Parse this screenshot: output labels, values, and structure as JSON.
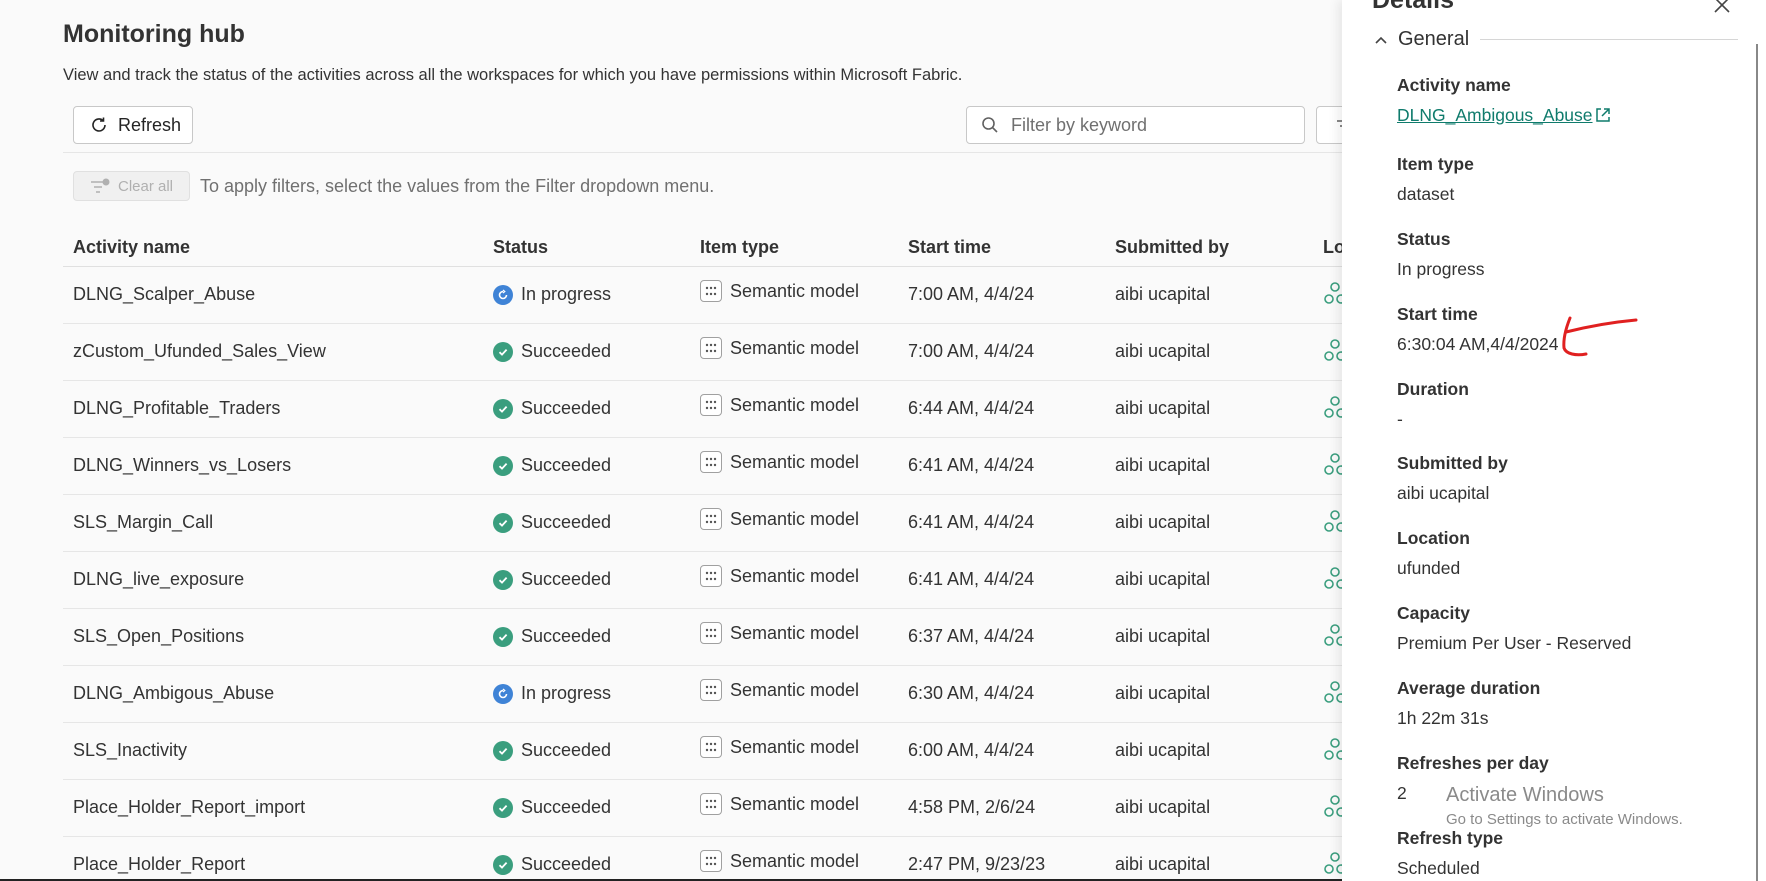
{
  "header": {
    "title": "Monitoring hub",
    "subtitle": "View and track the status of the activities across all the workspaces for which you have permissions within Microsoft Fabric."
  },
  "toolbar": {
    "refresh_label": "Refresh",
    "search_placeholder": "Filter by keyword",
    "clear_all_label": "Clear all",
    "filter_hint": "To apply filters, select the values from the Filter dropdown menu."
  },
  "table": {
    "columns": [
      "Activity name",
      "Status",
      "Item type",
      "Start time",
      "Submitted by",
      "Lo"
    ],
    "rows": [
      {
        "name": "DLNG_Scalper_Abuse",
        "status": "In progress",
        "type": "Semantic model",
        "start": "7:00 AM, 4/4/24",
        "by": "aibi ucapital"
      },
      {
        "name": "zCustom_Ufunded_Sales_View",
        "status": "Succeeded",
        "type": "Semantic model",
        "start": "7:00 AM, 4/4/24",
        "by": "aibi ucapital"
      },
      {
        "name": "DLNG_Profitable_Traders",
        "status": "Succeeded",
        "type": "Semantic model",
        "start": "6:44 AM, 4/4/24",
        "by": "aibi ucapital"
      },
      {
        "name": "DLNG_Winners_vs_Losers",
        "status": "Succeeded",
        "type": "Semantic model",
        "start": "6:41 AM, 4/4/24",
        "by": "aibi ucapital"
      },
      {
        "name": "SLS_Margin_Call",
        "status": "Succeeded",
        "type": "Semantic model",
        "start": "6:41 AM, 4/4/24",
        "by": "aibi ucapital"
      },
      {
        "name": "DLNG_live_exposure",
        "status": "Succeeded",
        "type": "Semantic model",
        "start": "6:41 AM, 4/4/24",
        "by": "aibi ucapital"
      },
      {
        "name": "SLS_Open_Positions",
        "status": "Succeeded",
        "type": "Semantic model",
        "start": "6:37 AM, 4/4/24",
        "by": "aibi ucapital"
      },
      {
        "name": "DLNG_Ambigous_Abuse",
        "status": "In progress",
        "type": "Semantic model",
        "start": "6:30 AM, 4/4/24",
        "by": "aibi ucapital"
      },
      {
        "name": "SLS_Inactivity",
        "status": "Succeeded",
        "type": "Semantic model",
        "start": "6:00 AM, 4/4/24",
        "by": "aibi ucapital"
      },
      {
        "name": "Place_Holder_Report_import",
        "status": "Succeeded",
        "type": "Semantic model",
        "start": "4:58 PM, 2/6/24",
        "by": "aibi ucapital"
      },
      {
        "name": "Place_Holder_Report",
        "status": "Succeeded",
        "type": "Semantic model",
        "start": "2:47 PM, 9/23/23",
        "by": "aibi ucapital"
      }
    ]
  },
  "details": {
    "title": "Details",
    "section": "General",
    "fields": [
      {
        "label": "Activity name",
        "value": "DLNG_Ambigous_Abuse"
      },
      {
        "label": "Item type",
        "value": "dataset"
      },
      {
        "label": "Status",
        "value": "In progress"
      },
      {
        "label": "Start time",
        "value": "6:30:04 AM,4/4/2024"
      },
      {
        "label": "Duration",
        "value": "-"
      },
      {
        "label": "Submitted by",
        "value": "aibi ucapital"
      },
      {
        "label": "Location",
        "value": "ufunded"
      },
      {
        "label": "Capacity",
        "value": "Premium Per User - Reserved"
      },
      {
        "label": "Average duration",
        "value": "1h 22m 31s"
      },
      {
        "label": "Refreshes per day",
        "value": "2"
      },
      {
        "label": "Refresh type",
        "value": "Scheduled"
      }
    ]
  },
  "watermark": {
    "line1": "Activate Windows",
    "line2": "Go to Settings to activate Windows."
  },
  "colors": {
    "succeeded": "#3a9e7e",
    "in_progress": "#3f83d6",
    "link": "#0f7b6c",
    "annotation": "#e02020"
  },
  "icons": {
    "refresh": "refresh-icon",
    "search": "search-icon",
    "filter": "filter-icon",
    "succeeded": "check-circle-icon",
    "in_progress": "in-progress-icon",
    "item_type": "semantic-model-icon",
    "location": "workspace-icon",
    "close": "close-icon",
    "collapse": "chevron-up-icon",
    "external": "open-external-icon"
  }
}
